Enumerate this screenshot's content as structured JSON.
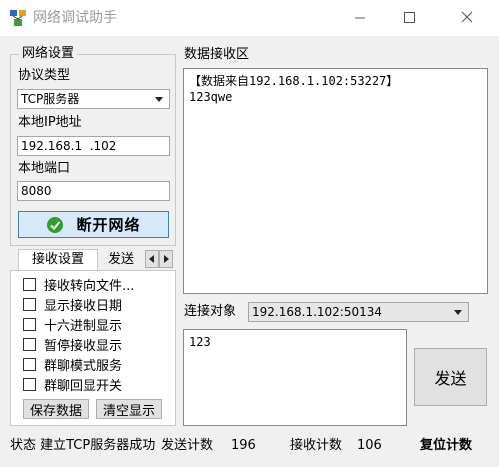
{
  "window": {
    "title": "网络调试助手",
    "controls": {
      "minimize": "—",
      "maximize": "☐",
      "close": "✕"
    }
  },
  "network": {
    "group_label": "网络设置",
    "protocol_label": "协议类型",
    "protocol_value": "TCP服务器",
    "local_ip_label": "本地IP地址",
    "local_ip_value": "192.168.1  .102",
    "local_port_label": "本地端口",
    "local_port_value": "8080",
    "connect_button_label": "断开网络",
    "connect_icon": "check-circle-icon"
  },
  "receive_settings": {
    "tabs": [
      {
        "label": "接收设置",
        "active": true
      },
      {
        "label": "发送",
        "active": false
      }
    ],
    "options": [
      {
        "label": "接收转向文件...",
        "checked": false
      },
      {
        "label": "显示接收日期",
        "checked": false
      },
      {
        "label": "十六进制显示",
        "checked": false
      },
      {
        "label": "暂停接收显示",
        "checked": false
      },
      {
        "label": "群聊模式服务",
        "checked": false
      },
      {
        "label": "群聊回显开关",
        "checked": false
      }
    ],
    "save_button_label": "保存数据",
    "clear_button_label": "清空显示"
  },
  "receive_area": {
    "label": "数据接收区",
    "content": "【数据来自192.168.1.102:53227】\n123qwe"
  },
  "send_area": {
    "target_label": "连接对象",
    "target_value": "192.168.1.102:50134",
    "send_text": "123",
    "send_button_label": "发送"
  },
  "status_bar": {
    "status_text": "状态 建立TCP服务器成功",
    "send_count_label": "发送计数",
    "send_count_value": "196",
    "recv_count_label": "接收计数",
    "recv_count_value": "106",
    "reset_label": "复位计数"
  },
  "colors": {
    "window_bg": "#f0f0f0",
    "titlebar_bg": "#ffffff",
    "connect_button_bg": "#d7e9f8",
    "connect_button_border": "#3c7fb1",
    "check_icon_green": "#2e9e2e"
  }
}
